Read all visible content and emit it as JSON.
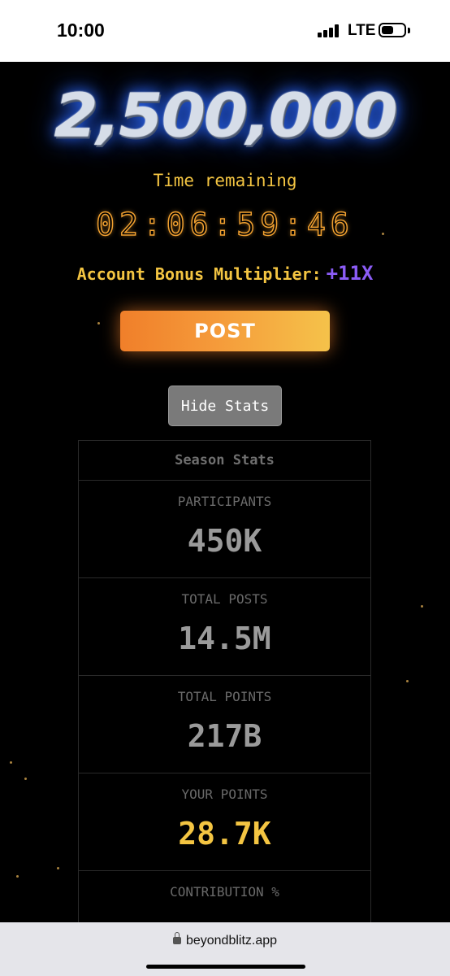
{
  "status_bar": {
    "time": "10:00",
    "network": "LTE",
    "icons": [
      "signal-bars-icon",
      "battery-icon"
    ]
  },
  "hero": {
    "jackpot": "2,500,000",
    "time_label": "Time remaining",
    "countdown": "02:06:59:46",
    "multiplier_label": "Account Bonus Multiplier:",
    "multiplier_value": "+11X"
  },
  "actions": {
    "post_label": "POST",
    "hide_stats_label": "Hide Stats"
  },
  "stats": {
    "title": "Season Stats",
    "items": [
      {
        "label": "PARTICIPANTS",
        "value": "450K"
      },
      {
        "label": "TOTAL POSTS",
        "value": "14.5M"
      },
      {
        "label": "TOTAL POINTS",
        "value": "217B"
      },
      {
        "label": "YOUR POINTS",
        "value": "28.7K"
      },
      {
        "label": "CONTRIBUTION %",
        "value": ""
      }
    ]
  },
  "browser": {
    "url": "beyondblitz.app"
  },
  "colors": {
    "accent_gold": "#f4c542",
    "countdown_orange": "#f0a030",
    "multiplier_purple": "#8b5cf6",
    "post_gradient_start": "#f07f2a",
    "post_gradient_end": "#f5c24a"
  }
}
